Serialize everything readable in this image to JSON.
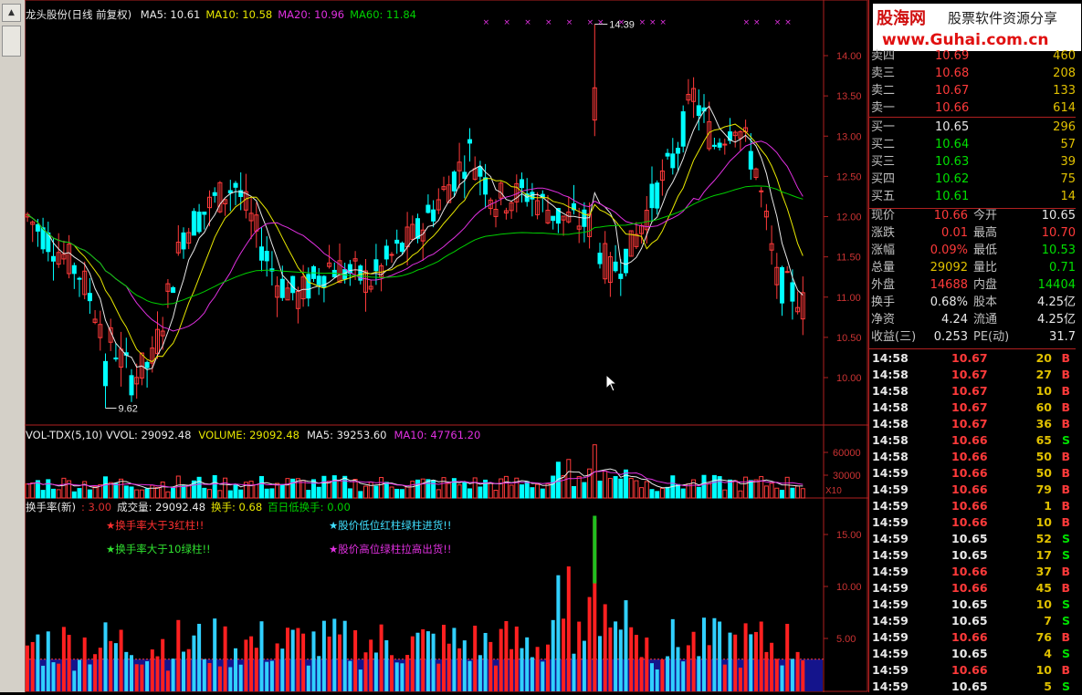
{
  "main_chart": {
    "title": "龙头股份(日线 前复权)",
    "ma_labels": [
      {
        "text": "MA5: 10.61",
        "color": "#e8e8e8"
      },
      {
        "text": "MA10: 10.58",
        "color": "#e8e800"
      },
      {
        "text": "MA20: 10.96",
        "color": "#e030e0"
      },
      {
        "text": "MA60: 11.84",
        "color": "#00d000"
      }
    ],
    "y_ticks": [
      "14.00",
      "13.50",
      "13.00",
      "12.50",
      "12.00",
      "11.50",
      "11.00",
      "10.50",
      "10.00"
    ],
    "high_marker": "14.39",
    "low_marker": "9.62"
  },
  "volume_chart": {
    "labels": [
      {
        "text": "VOL-TDX(5,10)  VVOL: 29092.48",
        "color": "#e8e8e8"
      },
      {
        "text": "VOLUME: 29092.48",
        "color": "#e8e800"
      },
      {
        "text": "MA5: 39253.60",
        "color": "#e8e8e8"
      },
      {
        "text": "MA10: 47761.20",
        "color": "#e030e0"
      }
    ],
    "y_ticks": [
      "60000",
      "30000"
    ],
    "unit": "X10"
  },
  "turnover_chart": {
    "labels": [
      {
        "text": "换手率(新)",
        "color": "#e8e8e8"
      },
      {
        "text": ": 3.00",
        "color": "#e03030"
      },
      {
        "text": "成交量: 29092.48",
        "color": "#e8e8e8"
      },
      {
        "text": "换手: 0.68",
        "color": "#e8e800"
      },
      {
        "text": "百日低换手: 0.00",
        "color": "#00d000"
      }
    ],
    "notes": [
      {
        "text": "★换手率大于3红柱!!",
        "color": "#ff3030"
      },
      {
        "text": "★股价低位红柱绿柱进货!!",
        "color": "#40e0ff"
      },
      {
        "text": "★换手率大于10绿柱!!",
        "color": "#30e030"
      },
      {
        "text": "★股价高位绿柱拉高出货!!",
        "color": "#e030e0"
      }
    ],
    "y_ticks": [
      "15.00",
      "10.00",
      "5.00"
    ]
  },
  "logo": {
    "brand": "股海网",
    "slogan": "股票软件资源分享",
    "url": "www.Guhai.com.cn"
  },
  "order_book": {
    "sells": [
      {
        "label": "卖四",
        "price": "10.69",
        "vol": "460"
      },
      {
        "label": "卖三",
        "price": "10.68",
        "vol": "208"
      },
      {
        "label": "卖二",
        "price": "10.67",
        "vol": "133"
      },
      {
        "label": "卖一",
        "price": "10.66",
        "vol": "614"
      }
    ],
    "buys": [
      {
        "label": "买一",
        "price": "10.65",
        "vol": "296",
        "color": "white"
      },
      {
        "label": "买二",
        "price": "10.64",
        "vol": "57",
        "color": "green"
      },
      {
        "label": "买三",
        "price": "10.63",
        "vol": "39",
        "color": "green"
      },
      {
        "label": "买四",
        "price": "10.62",
        "vol": "75",
        "color": "green"
      },
      {
        "label": "买五",
        "price": "10.61",
        "vol": "14",
        "color": "green"
      }
    ]
  },
  "stats": [
    {
      "l1": "现价",
      "v1": "10.66",
      "c1": "red",
      "l2": "今开",
      "v2": "10.65",
      "c2": "white"
    },
    {
      "l1": "涨跌",
      "v1": "0.01",
      "c1": "red",
      "l2": "最高",
      "v2": "10.70",
      "c2": "red"
    },
    {
      "l1": "涨幅",
      "v1": "0.09%",
      "c1": "red",
      "l2": "最低",
      "v2": "10.53",
      "c2": "green"
    },
    {
      "l1": "总量",
      "v1": "29092",
      "c1": "yellow",
      "l2": "量比",
      "v2": "0.71",
      "c2": "green"
    },
    {
      "l1": "外盘",
      "v1": "14688",
      "c1": "red",
      "l2": "内盘",
      "v2": "14404",
      "c2": "green"
    },
    {
      "l1": "换手",
      "v1": "0.68%",
      "c1": "white",
      "l2": "股本",
      "v2": "4.25亿",
      "c2": "white"
    },
    {
      "l1": "净资",
      "v1": "4.24",
      "c1": "white",
      "l2": "流通",
      "v2": "4.25亿",
      "c2": "white"
    },
    {
      "l1": "收益(三)",
      "v1": "0.253",
      "c1": "white",
      "l2": "PE(动)",
      "v2": "31.7",
      "c2": "white"
    }
  ],
  "ticks": [
    {
      "time": "14:58",
      "price": "10.67",
      "vol": "20",
      "bs": "B"
    },
    {
      "time": "14:58",
      "price": "10.67",
      "vol": "27",
      "bs": "B"
    },
    {
      "time": "14:58",
      "price": "10.67",
      "vol": "10",
      "bs": "B"
    },
    {
      "time": "14:58",
      "price": "10.67",
      "vol": "60",
      "bs": "B"
    },
    {
      "time": "14:58",
      "price": "10.67",
      "vol": "36",
      "bs": "B"
    },
    {
      "time": "14:58",
      "price": "10.66",
      "vol": "65",
      "bs": "S"
    },
    {
      "time": "14:58",
      "price": "10.66",
      "vol": "50",
      "bs": "B"
    },
    {
      "time": "14:59",
      "price": "10.66",
      "vol": "50",
      "bs": "B"
    },
    {
      "time": "14:59",
      "price": "10.66",
      "vol": "79",
      "bs": "B"
    },
    {
      "time": "14:59",
      "price": "10.66",
      "vol": "1",
      "bs": "B"
    },
    {
      "time": "14:59",
      "price": "10.66",
      "vol": "10",
      "bs": "B"
    },
    {
      "time": "14:59",
      "price": "10.65",
      "vol": "52",
      "bs": "S"
    },
    {
      "time": "14:59",
      "price": "10.65",
      "vol": "17",
      "bs": "S"
    },
    {
      "time": "14:59",
      "price": "10.66",
      "vol": "37",
      "bs": "B"
    },
    {
      "time": "14:59",
      "price": "10.66",
      "vol": "45",
      "bs": "B"
    },
    {
      "time": "14:59",
      "price": "10.65",
      "vol": "10",
      "bs": "S"
    },
    {
      "time": "14:59",
      "price": "10.65",
      "vol": "7",
      "bs": "S"
    },
    {
      "time": "14:59",
      "price": "10.66",
      "vol": "76",
      "bs": "B"
    },
    {
      "time": "14:59",
      "price": "10.65",
      "vol": "4",
      "bs": "S"
    },
    {
      "time": "14:59",
      "price": "10.66",
      "vol": "10",
      "bs": "B"
    },
    {
      "time": "14:59",
      "price": "10.65",
      "vol": "5",
      "bs": "S"
    }
  ]
}
